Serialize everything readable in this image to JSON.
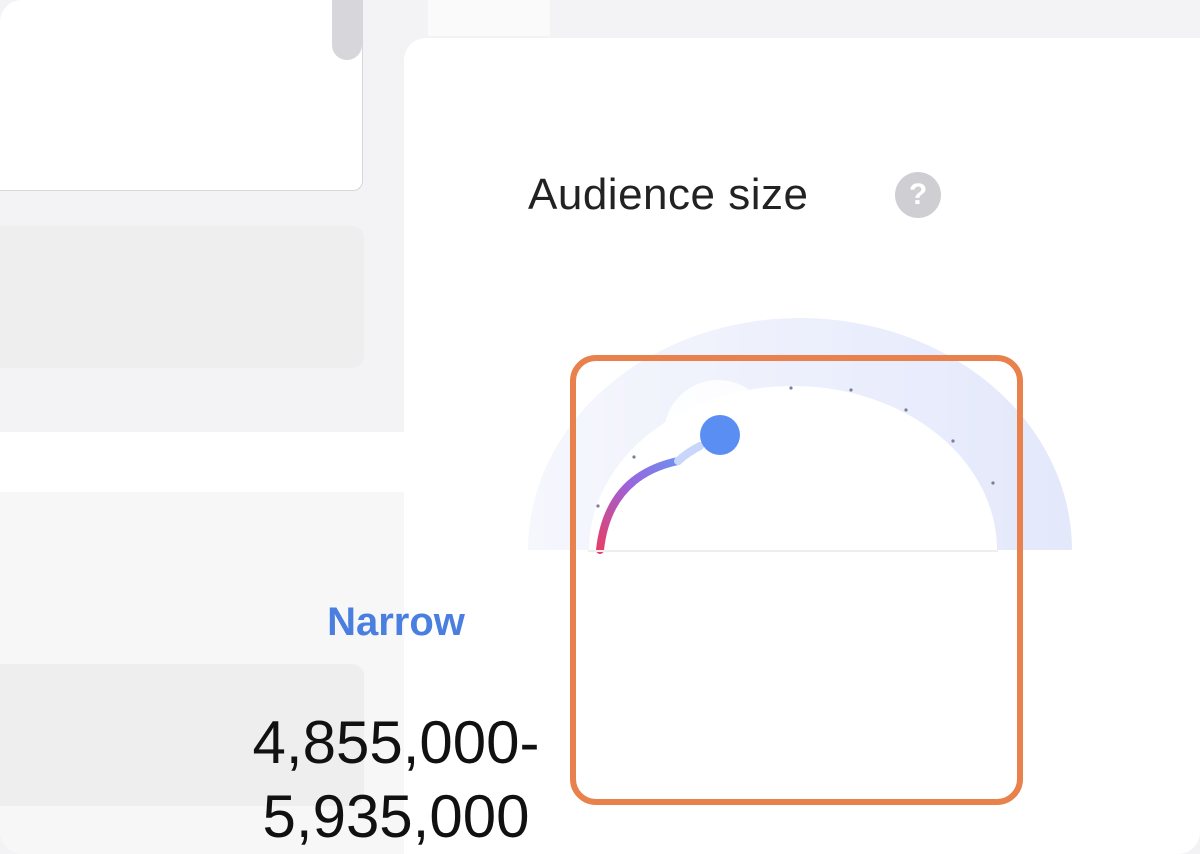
{
  "audience": {
    "title": "Audience size",
    "help_icon": "question-mark-icon",
    "level_label": "Narrow",
    "range_text": "4,855,000-\n5,935,000",
    "gauge_level": 0.22
  },
  "colors": {
    "accent_blue": "#4a7fe0",
    "knob_blue": "#5b8ef2",
    "gradient_start": "#e63e6b",
    "gradient_end": "#6f8ff0",
    "gauge_track": "#eef1fc",
    "highlight_orange": "#e8814c"
  }
}
